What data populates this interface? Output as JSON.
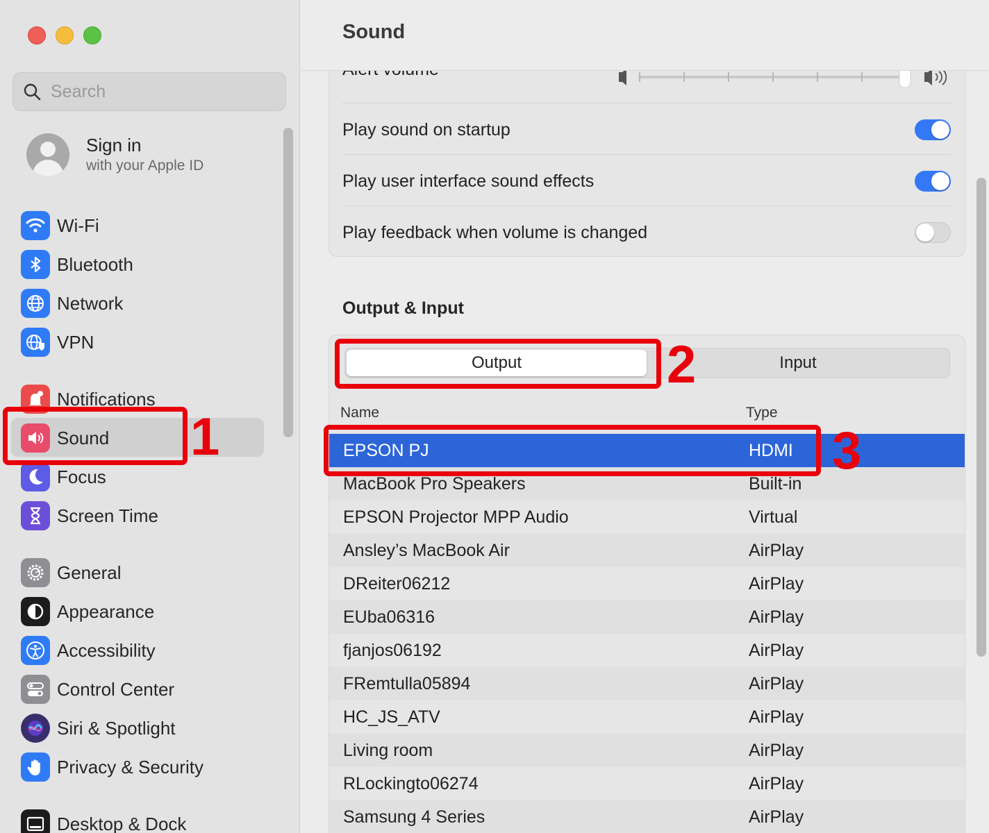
{
  "window": {
    "title": "Sound"
  },
  "search": {
    "placeholder": "Search"
  },
  "account": {
    "title": "Sign in",
    "subtitle": "with your Apple ID"
  },
  "sidebar": {
    "items": [
      {
        "label": "Wi-Fi",
        "icon": "wifi-icon",
        "color": "#2f7bf5"
      },
      {
        "label": "Bluetooth",
        "icon": "bluetooth-icon",
        "color": "#2f7bf5"
      },
      {
        "label": "Network",
        "icon": "globe-icon",
        "color": "#2f7bf5"
      },
      {
        "label": "VPN",
        "icon": "vpn-icon",
        "color": "#2f7bf5"
      },
      {
        "label": "Notifications",
        "icon": "bell-icon",
        "color": "#ec4b4b"
      },
      {
        "label": "Sound",
        "icon": "speaker-icon",
        "color": "#e94b6a",
        "selected": true
      },
      {
        "label": "Focus",
        "icon": "moon-icon",
        "color": "#5e5ce6"
      },
      {
        "label": "Screen Time",
        "icon": "hourglass-icon",
        "color": "#6c4fd8"
      },
      {
        "label": "General",
        "icon": "gear-icon",
        "color": "#8e8e93"
      },
      {
        "label": "Appearance",
        "icon": "appearance-icon",
        "color": "#1c1c1e"
      },
      {
        "label": "Accessibility",
        "icon": "accessibility-icon",
        "color": "#2f7bf5"
      },
      {
        "label": "Control Center",
        "icon": "control-center-icon",
        "color": "#8e8e93"
      },
      {
        "label": "Siri & Spotlight",
        "icon": "siri-icon",
        "color": "#3a2d6b"
      },
      {
        "label": "Privacy & Security",
        "icon": "hand-icon",
        "color": "#2f7bf5"
      },
      {
        "label": "Desktop & Dock",
        "icon": "dock-icon",
        "color": "#1c1c1e"
      }
    ]
  },
  "sound_effects": {
    "alert_volume_label": "Alert volume",
    "alert_volume_level": 1.0,
    "settings": [
      {
        "label": "Play sound on startup",
        "on": true
      },
      {
        "label": "Play user interface sound effects",
        "on": true
      },
      {
        "label": "Play feedback when volume is changed",
        "on": false
      }
    ]
  },
  "output_input": {
    "title": "Output & Input",
    "tabs": [
      "Output",
      "Input"
    ],
    "active_tab": "Output",
    "columns": [
      "Name",
      "Type"
    ],
    "devices": [
      {
        "name": "EPSON PJ",
        "type": "HDMI",
        "selected": true
      },
      {
        "name": "MacBook Pro Speakers",
        "type": "Built-in"
      },
      {
        "name": "EPSON Projector MPP Audio",
        "type": "Virtual"
      },
      {
        "name": "Ansley’s MacBook Air",
        "type": "AirPlay"
      },
      {
        "name": "DReiter06212",
        "type": "AirPlay"
      },
      {
        "name": "EUba06316",
        "type": "AirPlay"
      },
      {
        "name": "fjanjos06192",
        "type": "AirPlay"
      },
      {
        "name": "FRemtulla05894",
        "type": "AirPlay"
      },
      {
        "name": "HC_JS_ATV",
        "type": "AirPlay"
      },
      {
        "name": "Living room",
        "type": "AirPlay"
      },
      {
        "name": "RLockingto06274",
        "type": "AirPlay"
      },
      {
        "name": "Samsung 4 Series",
        "type": "AirPlay"
      }
    ]
  },
  "annotations": [
    "1",
    "2",
    "3"
  ],
  "colors": {
    "accent": "#3478f6",
    "selection": "#2c65d8",
    "annotation": "#e8000b"
  }
}
